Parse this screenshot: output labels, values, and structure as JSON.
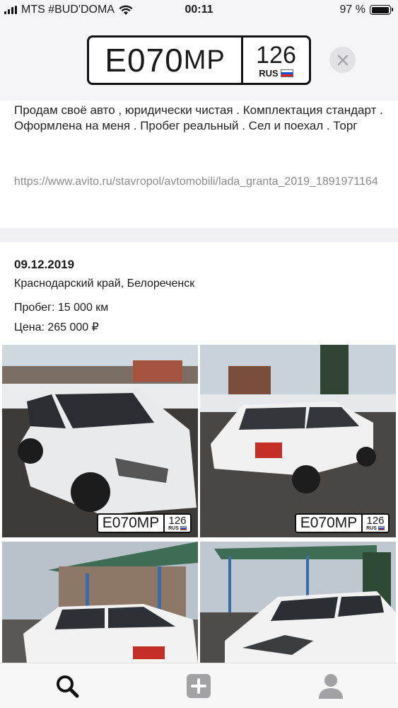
{
  "status_bar": {
    "carrier": "MTS #BUD'DOMA",
    "time": "00:11",
    "battery": "97 %",
    "battery_level": 0.97
  },
  "plate": {
    "letter1": "Е",
    "digits": "070",
    "letters2": "МР",
    "region": "126",
    "country": "RUS"
  },
  "plate_small": {
    "main": "Е070МР",
    "region": "126",
    "country": "RUS"
  },
  "description": "Продам своё авто , юридически чистая . Комплектация стандарт . Оформлена на меня . Пробег реальный . Сел и поехал . Торг",
  "link": "https://www.avito.ru/stavropol/avtomobili/lada_granta_2019_1891971164",
  "listing": {
    "date": "09.12.2019",
    "region": "Краснодарский край, Белореченск",
    "mileage": "Пробег: 15 000 км",
    "price": "Цена: 265 000 ₽"
  },
  "photos": [
    {
      "name": "photo-front-left"
    },
    {
      "name": "photo-rear-right"
    },
    {
      "name": "photo-side-shelter"
    },
    {
      "name": "photo-front-shelter"
    }
  ],
  "tabbar": {
    "tabs": [
      {
        "name": "search-icon",
        "active": true
      },
      {
        "name": "add-icon",
        "active": false
      },
      {
        "name": "profile-icon",
        "active": false
      }
    ]
  },
  "colors": {
    "accent": "#111111",
    "muted_link": "#8a8a8a",
    "background": "#efeff4",
    "card": "#ffffff"
  }
}
